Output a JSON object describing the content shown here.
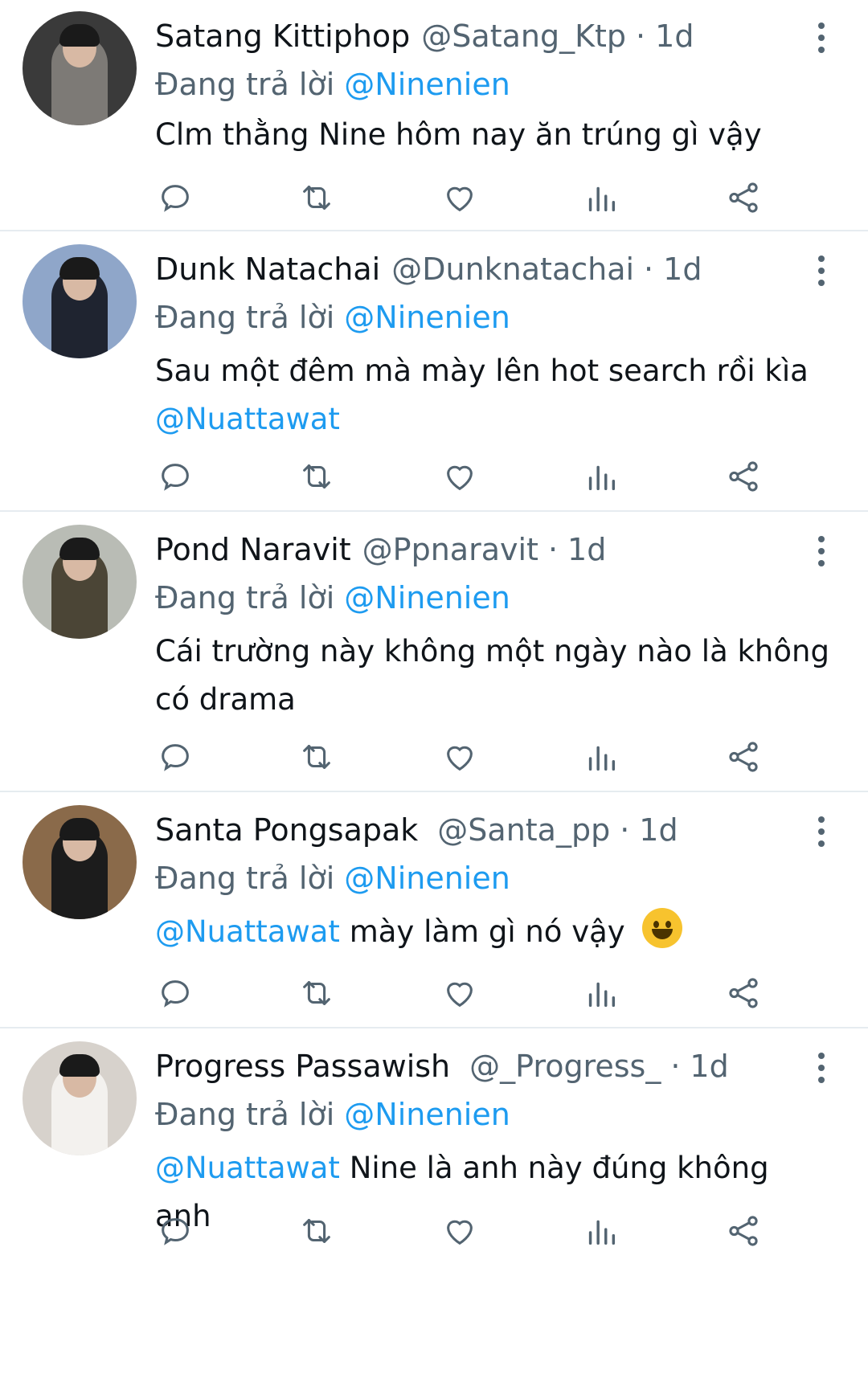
{
  "reply_prefix": "Đang trả lời",
  "colors": {
    "accent": "#1d9bf0",
    "muted": "#536471",
    "text": "#0f1419",
    "divider": "#e6ecf0"
  },
  "icons": [
    "reply-icon",
    "retweet-icon",
    "like-icon",
    "views-icon",
    "share-icon",
    "more-icon"
  ],
  "tweets": [
    {
      "name": "Satang Kittiphop",
      "handle": "@Satang_Ktp",
      "time": "1d",
      "reply_to": "@Ninenien",
      "text_pre": "",
      "mention": "",
      "text": "Clm thằng Nine hôm nay ăn trúng gì vậy"
    },
    {
      "name": "Dunk Natachai",
      "handle": "@Dunknatachai",
      "time": "1d",
      "reply_to": "@Ninenien",
      "text": "Sau một đêm mà mày lên hot search rồi kìa",
      "mention_after": "@Nuattawat"
    },
    {
      "name": "Pond Naravit",
      "handle": "@Ppnaravit",
      "time": "1d",
      "reply_to": "@Ninenien",
      "text": "Cái trường này không một ngày nào là không có drama"
    },
    {
      "name": "Santa Pongsapak",
      "handle": "@Santa_pp",
      "time": "1d",
      "reply_to": "@Ninenien",
      "mention": "@Nuattawat",
      "text": "mày làm gì nó vậy",
      "emoji": "grinning-face-emoji"
    },
    {
      "name": "Progress Passawish",
      "handle": "@_Progress_",
      "time": "1d",
      "reply_to": "@Ninenien",
      "mention": "@Nuattawat",
      "text": "Nine là anh này đúng không anh"
    }
  ]
}
